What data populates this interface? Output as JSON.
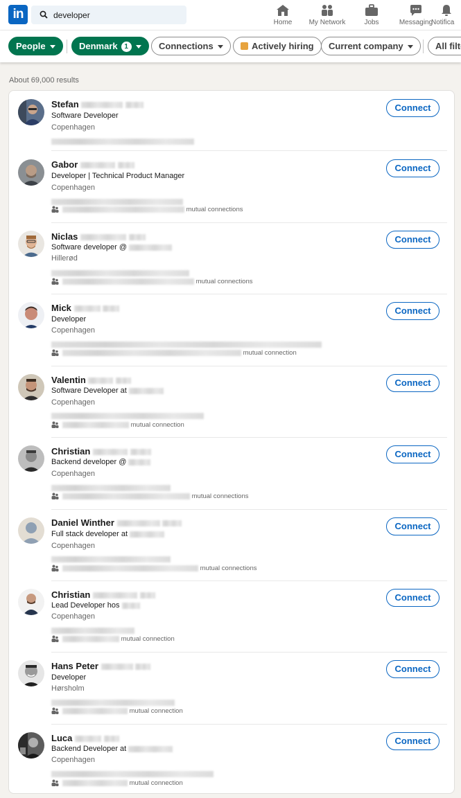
{
  "nav": {
    "logo": "in",
    "search_value": "developer",
    "items": [
      {
        "label": "Home",
        "icon": "home-icon"
      },
      {
        "label": "My Network",
        "icon": "network-icon"
      },
      {
        "label": "Jobs",
        "icon": "briefcase-icon"
      },
      {
        "label": "Messaging",
        "icon": "messaging-icon"
      },
      {
        "label": "Notifica",
        "icon": "bell-icon"
      }
    ]
  },
  "filters": {
    "people": "People",
    "denmark": "Denmark",
    "denmark_count": "1",
    "connections": "Connections",
    "actively_hiring": "Actively hiring",
    "current_company": "Current company",
    "all_filters": "All filters"
  },
  "results_count": "About 69,000 results",
  "colors": {
    "brand": "#0a66c2",
    "filter_active": "#01754f"
  },
  "people": [
    {
      "name": "Stefan",
      "title": "Software Developer",
      "location": "Copenhagen",
      "mutual": "",
      "connect": "Connect"
    },
    {
      "name": "Gabor",
      "title": "Developer | Technical Product Manager",
      "location": "Copenhagen",
      "mutual": "mutual connections",
      "connect": "Connect"
    },
    {
      "name": "Niclas",
      "title": "Software developer @",
      "location": "Hillerød",
      "mutual": "mutual connections",
      "connect": "Connect"
    },
    {
      "name": "Mick",
      "title": "Developer",
      "location": "Copenhagen",
      "mutual": "mutual connection",
      "connect": "Connect"
    },
    {
      "name": "Valentin",
      "title": "Software Developer at",
      "location": "Copenhagen",
      "mutual": "mutual connection",
      "connect": "Connect"
    },
    {
      "name": "Christian",
      "title": "Backend developer @",
      "location": "Copenhagen",
      "mutual": "mutual connections",
      "connect": "Connect"
    },
    {
      "name": "Daniel Winther",
      "title": "Full stack developer at",
      "location": "Copenhagen",
      "mutual": "mutual connections",
      "connect": "Connect"
    },
    {
      "name": "Christian",
      "title": "Lead Developer hos",
      "location": "Copenhagen",
      "mutual": "mutual connection",
      "connect": "Connect"
    },
    {
      "name": "Hans Peter",
      "title": "Developer",
      "location": "Hørsholm",
      "mutual": "mutual connection",
      "connect": "Connect"
    },
    {
      "name": "Luca",
      "title": "Backend Developer at",
      "location": "Copenhagen",
      "mutual": "mutual connection",
      "connect": "Connect"
    }
  ]
}
